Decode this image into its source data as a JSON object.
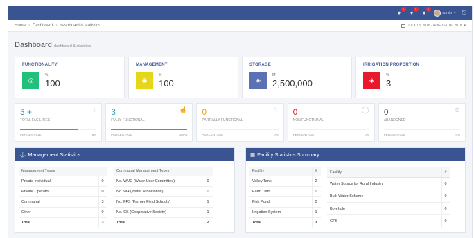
{
  "topbar": {
    "notifications": [
      {
        "icon": "bell-icon",
        "count": "1"
      },
      {
        "icon": "bell-icon",
        "count": "1"
      },
      {
        "icon": "bell-icon",
        "count": "1"
      }
    ],
    "user_name": "admin",
    "logout_icon": "logout-icon"
  },
  "breadcrumb": {
    "home": "Home",
    "dashboard": "Dashboard",
    "current": "dashboard & statistics"
  },
  "date_range": "JULY 18, 2018 - AUGUST 16, 2018",
  "page": {
    "title": "Dashboard",
    "subtitle": "dashboard & statistics"
  },
  "summary_cards": [
    {
      "label": "FUNCTIONALITY",
      "unit": "%",
      "value": "100",
      "color": "#22c07a",
      "icon": "bulb-icon"
    },
    {
      "label": "MANAGEMENT",
      "unit": "%",
      "value": "100",
      "color": "#e6d61a",
      "icon": "eye-icon"
    },
    {
      "label": "STORAGE",
      "unit": "M³",
      "value": "2,500,000",
      "color": "#5a72b4",
      "icon": "layers-icon"
    },
    {
      "label": "IRRIGATION PROPORTION",
      "unit": "%",
      "value": "3",
      "color": "#e8192c",
      "icon": "layers-icon"
    }
  ],
  "stat_cards": [
    {
      "value": "3 +",
      "label": "TOTAL FACILITIES",
      "percent_label": "PERCENTAGE",
      "percent": "76%",
      "fill": 0.76,
      "color": "#2fa4b8",
      "icon": "arrow-up-icon"
    },
    {
      "value": "3",
      "label": "FULLY FUNCTIONAL",
      "percent_label": "PERCENTAGE",
      "percent": "100%",
      "fill": 1.0,
      "color": "#2fa4b8",
      "icon": "thumbs-up-icon"
    },
    {
      "value": "0",
      "label": "PARTIALLY FUNCTIONAL",
      "percent_label": "PERCENTAGE",
      "percent": "0%",
      "fill": 0,
      "color": "#f0a020",
      "icon": "star-icon"
    },
    {
      "value": "0",
      "label": "NON FUNCTIONAL",
      "percent_label": "PERCENTAGE",
      "percent": "0%",
      "fill": 0,
      "color": "#e8192c",
      "icon": "comment-icon"
    },
    {
      "value": "0",
      "label": "ABANDONED",
      "percent_label": "PERCENTAGE",
      "percent": "0%",
      "fill": 0,
      "color": "#555555",
      "icon": "ban-icon"
    }
  ],
  "management_panel": {
    "title": "Management Statistics",
    "types": {
      "header": "Management Types",
      "rows": [
        {
          "name": "Private Individual",
          "count": "0"
        },
        {
          "name": "Private Operator",
          "count": "0"
        },
        {
          "name": "Communal",
          "count": "3"
        },
        {
          "name": "Other",
          "count": "0"
        }
      ],
      "total_label": "Total",
      "total": "3"
    },
    "communal": {
      "header": "Communal Management Types",
      "rows": [
        {
          "name": "No. WUC (Water User Committee)",
          "count": "0"
        },
        {
          "name": "No. WA (Water Association)",
          "count": "0"
        },
        {
          "name": "No. FFS (Farmer Field Schools)",
          "count": "1"
        },
        {
          "name": "No. CS (Cooperative Society)",
          "count": "1"
        }
      ],
      "total_label": "Total",
      "total": "2"
    }
  },
  "facility_panel": {
    "title": "Facility Statistics Summary",
    "left": {
      "header": "Facility",
      "count_header": "#",
      "rows": [
        {
          "name": "Valley Tank",
          "count": "2"
        },
        {
          "name": "Earth Dam",
          "count": "0"
        },
        {
          "name": "Fish Pond",
          "count": "0"
        },
        {
          "name": "Irrigation System",
          "count": "1"
        }
      ],
      "total_label": "Total",
      "total": "3"
    },
    "right": {
      "header": "Facility",
      "count_header": "#",
      "rows": [
        {
          "name": "Water Source for Rural Industry",
          "count": "0"
        },
        {
          "name": "Bulk Water Scheme",
          "count": "0"
        },
        {
          "name": "Borehole",
          "count": "0"
        },
        {
          "name": "GFS",
          "count": "0"
        }
      ]
    }
  }
}
